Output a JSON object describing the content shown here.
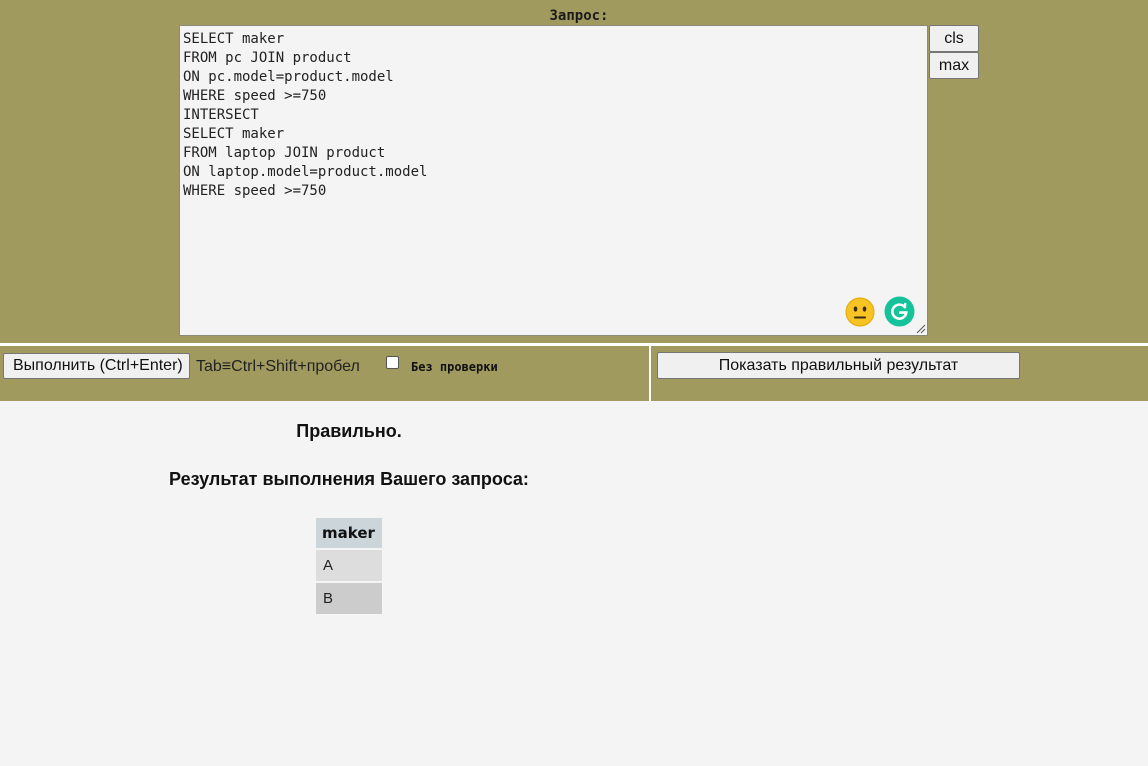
{
  "editor": {
    "label": "Запрос:",
    "query": "SELECT maker\nFROM pc JOIN product\nON pc.model=product.model\nWHERE speed >=750\nINTERSECT\nSELECT maker\nFROM laptop JOIN product\nON laptop.model=product.model\nWHERE speed >=750",
    "icons": [
      "neutral-face-emoji-icon",
      "grammarly-icon",
      "resize-grip-icon"
    ]
  },
  "side_buttons": {
    "cls_label": "cls",
    "max_label": "max"
  },
  "controls": {
    "run_label": "Выполнить (Ctrl+Enter)",
    "tab_hint": "Tab≡Ctrl+Shift+пробел",
    "nocheck_label": "Без проверки",
    "nocheck_checked": false,
    "show_result_label": "Показать правильный результат"
  },
  "result": {
    "status": "Правильно.",
    "title": "Результат выполнения Вашего запроса:",
    "columns": [
      "maker"
    ],
    "rows": [
      [
        "A"
      ],
      [
        "B"
      ]
    ]
  },
  "colors": {
    "panel": "#a09a5f",
    "background": "#f4f4f4",
    "header_cell": "#cbd5da",
    "row_odd": "#dddddd",
    "row_even": "#cccccc",
    "grammarly": "#15c39a",
    "emoji": "#f7c325"
  }
}
